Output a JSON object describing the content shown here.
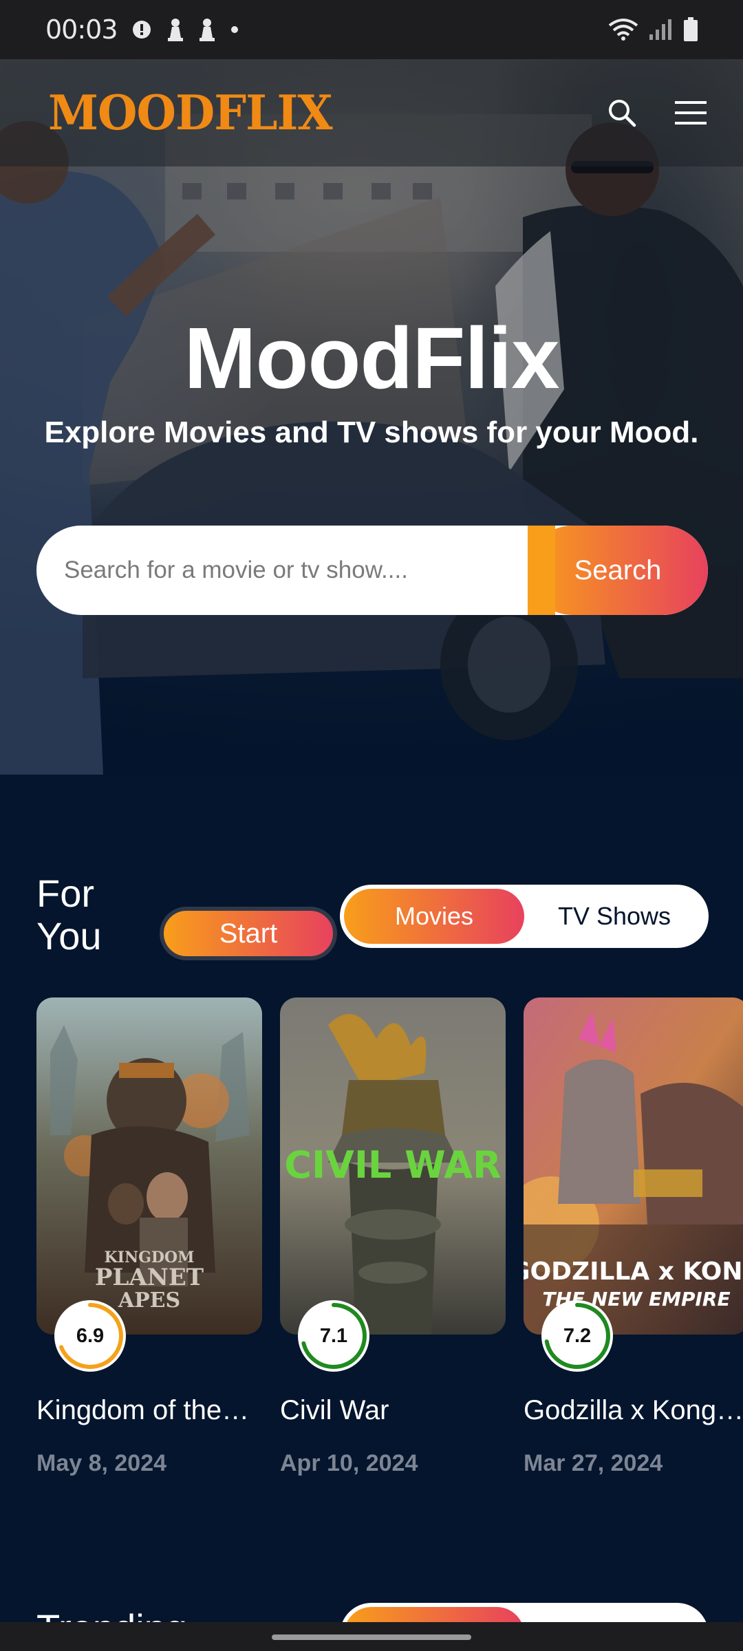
{
  "status_bar": {
    "time": "00:03",
    "icons": [
      "settings-alert-icon",
      "chess-pawn-icon",
      "chess-pawn-icon",
      "dot-icon",
      "wifi-icon",
      "signal-icon",
      "battery-icon"
    ]
  },
  "header": {
    "logo": "MOODFLIX",
    "search_icon": "search-icon",
    "menu_icon": "hamburger-menu-icon"
  },
  "hero": {
    "title": "MoodFlix",
    "subtitle": "Explore Movies and TV shows for your Mood.",
    "search_placeholder": "Search for a movie or tv show....",
    "search_button": "Search"
  },
  "for_you": {
    "title_line1": "For",
    "title_line2": "You",
    "start_label": "Start",
    "tabs": [
      {
        "label": "Movies",
        "active": true
      },
      {
        "label": "TV Shows",
        "active": false
      }
    ],
    "cards": [
      {
        "title": "Kingdom of the…",
        "date": "May 8, 2024",
        "rating": "6.9",
        "rating_fraction": 0.69,
        "ring_color": "#f4a21a",
        "poster_text": "KINGDOM PLANET APES"
      },
      {
        "title": "Civil War",
        "date": "Apr 10, 2024",
        "rating": "7.1",
        "rating_fraction": 0.71,
        "ring_color": "#1f8a1f",
        "poster_text": "CIVIL WAR"
      },
      {
        "title": "Godzilla x Kong…",
        "date": "Mar 27, 2024",
        "rating": "7.2",
        "rating_fraction": 0.72,
        "ring_color": "#1f8a1f",
        "poster_text": "GODZILLA x KONG"
      }
    ]
  },
  "trending": {
    "title": "Trending"
  },
  "colors": {
    "background": "#04152d",
    "accent_start": "#f89e1b",
    "accent_end": "#e7425d",
    "logo": "#f08a15"
  }
}
